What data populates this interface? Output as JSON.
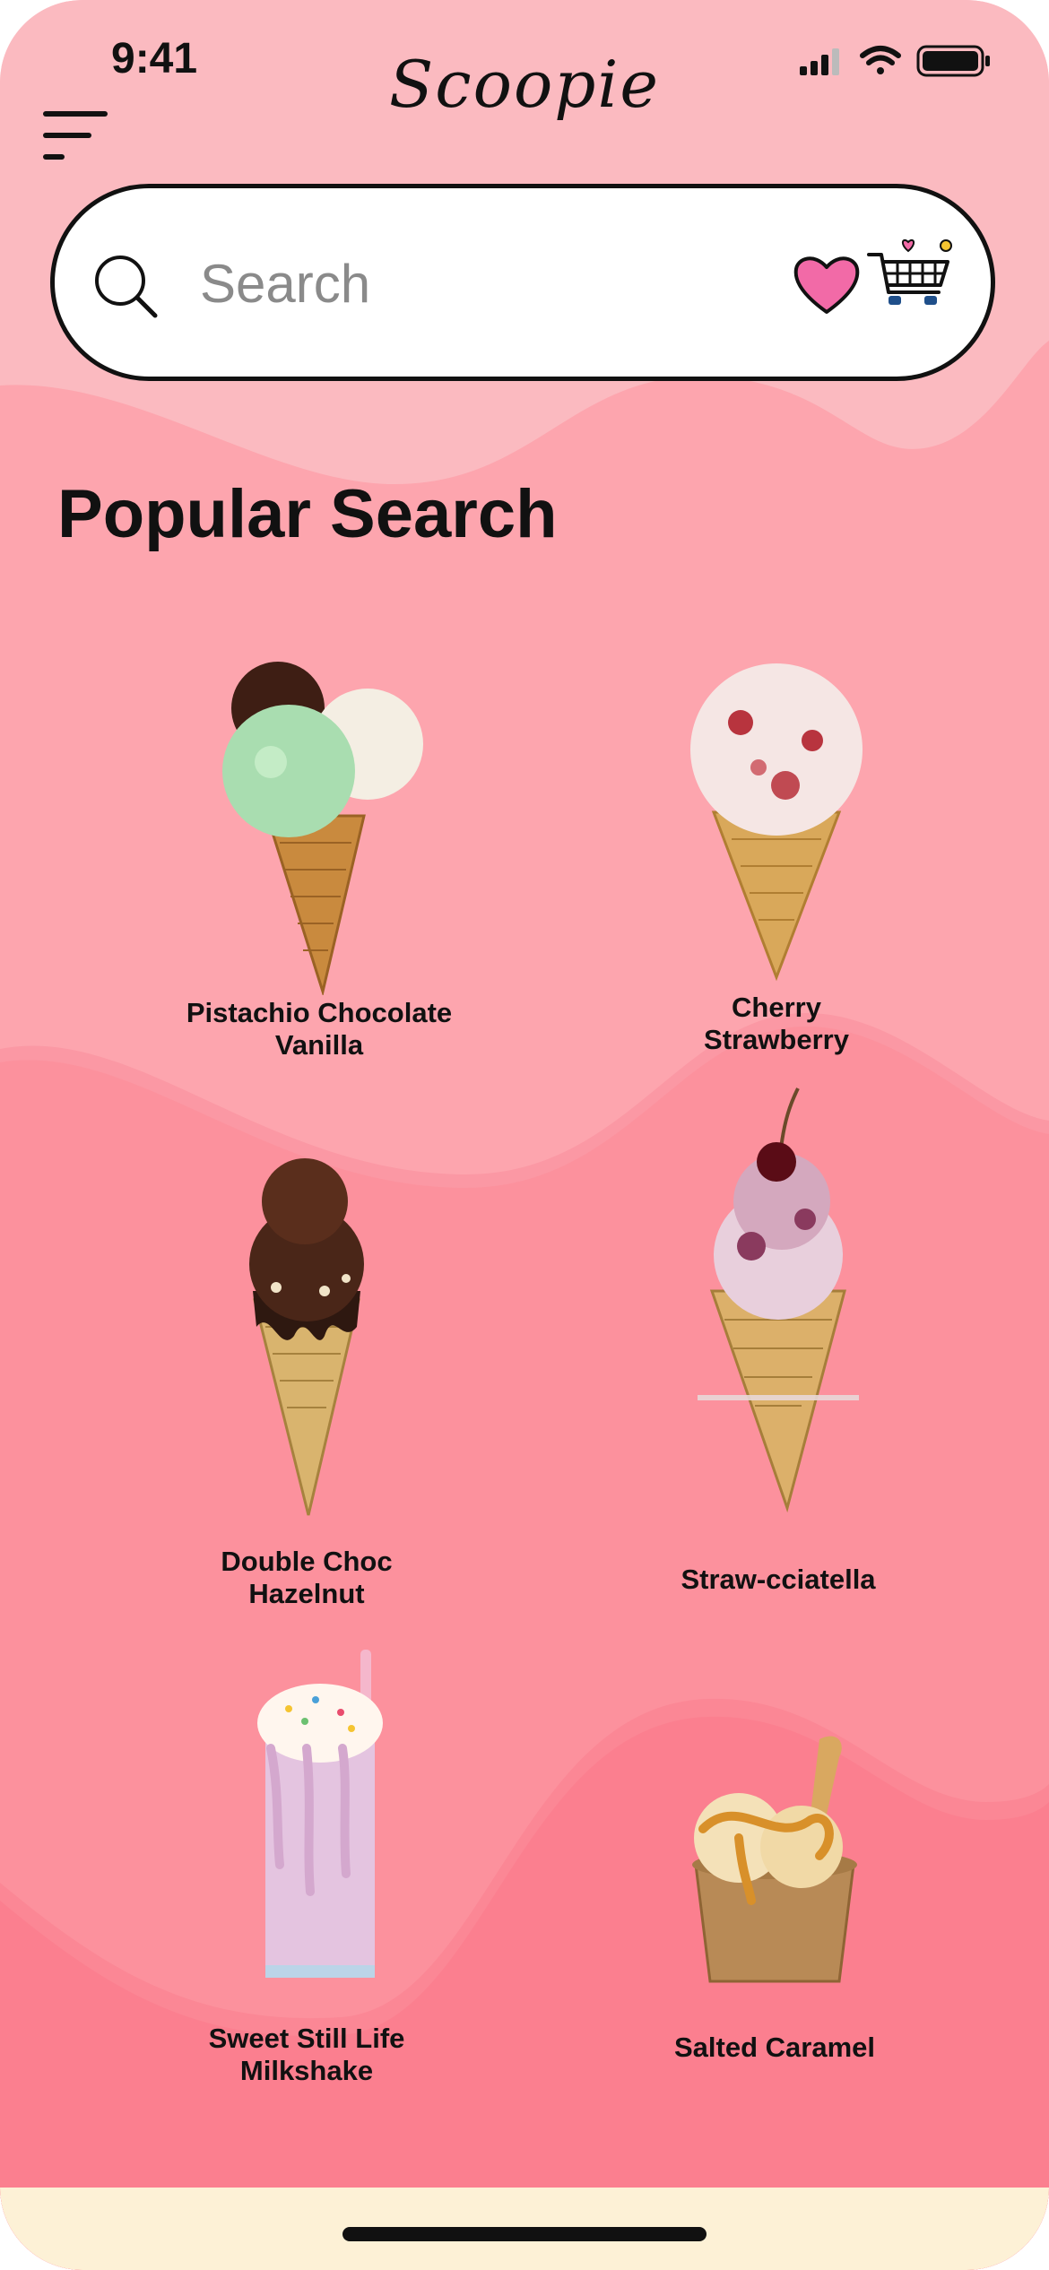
{
  "status_bar": {
    "time": "9:41"
  },
  "header": {
    "logo_text": "Scoopie"
  },
  "search": {
    "placeholder": "Search"
  },
  "section": {
    "title": "Popular Search"
  },
  "products": [
    {
      "line1": "Pistachio Chocolate",
      "line2": "Vanilla"
    },
    {
      "line1": "Cherry",
      "line2": "Strawberry"
    },
    {
      "line1": "Double Choc",
      "line2": "Hazelnut"
    },
    {
      "line1": "Straw-cciatella",
      "line2": ""
    },
    {
      "line1": "Sweet Still Life",
      "line2": "Milkshake"
    },
    {
      "line1": "Salted Caramel",
      "line2": ""
    }
  ],
  "icons": {
    "menu": "hamburger-menu-icon",
    "search": "search-icon",
    "favorites": "heart-icon",
    "cart": "shopping-cart-icon"
  },
  "colors": {
    "background_top": "#FBBAC0",
    "band_1": "#FDA5AE",
    "band_2": "#FC919D",
    "band_3": "#FB7F8F",
    "footer": "#FDF1D6",
    "accent_pink": "#F26AA7",
    "text": "#111111"
  }
}
